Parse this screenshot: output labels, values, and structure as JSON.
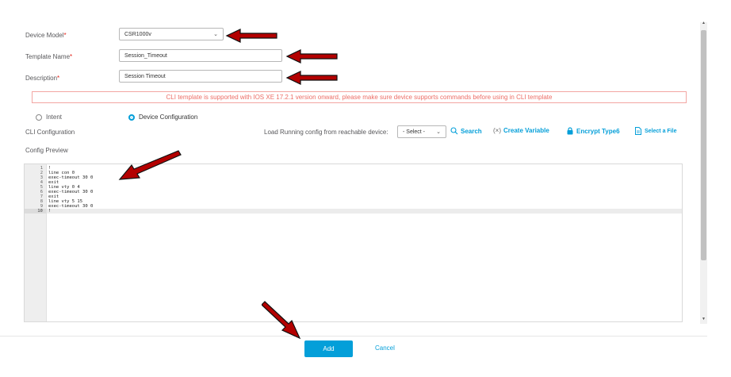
{
  "form": {
    "device_model": {
      "label": "Device Model",
      "required": "*",
      "value": "CSR1000v"
    },
    "template_name": {
      "label": "Template Name",
      "required": "*",
      "value": "Session_Timeout"
    },
    "description": {
      "label": "Description",
      "required": "*",
      "value": "Session Timeout"
    }
  },
  "warning": "CLI template is supported with IOS XE 17.2.1 version onward, please make sure device supports commands before using in CLI template",
  "mode": {
    "intent_label": "Intent",
    "device_config_label": "Device Configuration",
    "selected": "Device Configuration"
  },
  "cli": {
    "title": "CLI Configuration",
    "load_label": "Load Running config from reachable device:",
    "select_value": "- Select -",
    "search_label": "Search",
    "create_variable_label": "Create Variable",
    "encrypt_label": "Encrypt Type6",
    "select_file_label": "Select a File",
    "preview_title": "Config Preview"
  },
  "editor": {
    "lines": [
      {
        "n": "1",
        "text": "!"
      },
      {
        "n": "2",
        "text": "line con 0"
      },
      {
        "n": "3",
        "text": "exec-timeout 30 0"
      },
      {
        "n": "4",
        "text": "exit"
      },
      {
        "n": "5",
        "text": "line vty 0 4"
      },
      {
        "n": "6",
        "text": "exec-timeout 30 0"
      },
      {
        "n": "7",
        "text": "exit"
      },
      {
        "n": "8",
        "text": "line vty 5 15"
      },
      {
        "n": "9",
        "text": "exec-timeout 30 0"
      },
      {
        "n": "10",
        "text": "!"
      }
    ],
    "active_line": 10
  },
  "footer": {
    "add_label": "Add",
    "cancel_label": "Cancel"
  },
  "colors": {
    "accent": "#049fd9",
    "warning_text": "#ec6e67",
    "arrow": "#b30000"
  },
  "icons": [
    "chevron-down-icon",
    "search-icon",
    "variable-icon",
    "lock-icon",
    "file-icon",
    "red-arrow-annotation"
  ]
}
